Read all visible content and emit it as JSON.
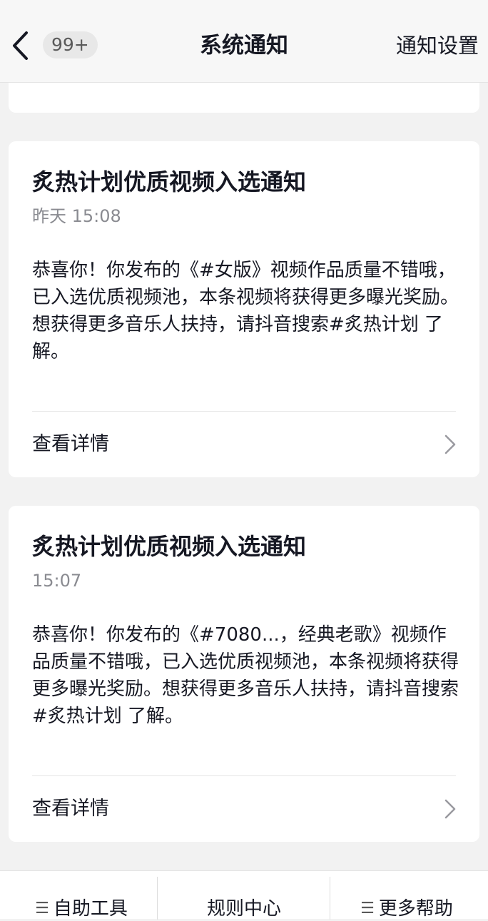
{
  "header": {
    "badge": "99+",
    "title": "系统通知",
    "settings_label": "通知设置"
  },
  "notifications": [
    {
      "title": "炙热计划优质视频入选通知",
      "time": "昨天 15:08",
      "body": "恭喜你！你发布的《#女版》视频作品质量不错哦，已入选优质视频池，本条视频将获得更多曝光奖励。想获得更多音乐人扶持，请抖音搜索#炙热计划 了解。",
      "link_label": "查看详情"
    },
    {
      "title": "炙热计划优质视频入选通知",
      "time": "15:07",
      "body": "恭喜你！你发布的《#7080...，经典老歌》视频作品质量不错哦，已入选优质视频池，本条视频将获得更多曝光奖励。想获得更多音乐人扶持，请抖音搜索#炙热计划 了解。",
      "link_label": "查看详情"
    }
  ],
  "bottom_bar": {
    "items": [
      {
        "label": "自助工具",
        "icon": "menu-icon"
      },
      {
        "label": "规则中心"
      },
      {
        "label": "更多帮助",
        "icon": "menu-icon"
      }
    ]
  },
  "colors": {
    "background": "#f2f2f2",
    "card": "#ffffff",
    "text_primary": "#161823",
    "text_secondary": "#8a8b91"
  }
}
